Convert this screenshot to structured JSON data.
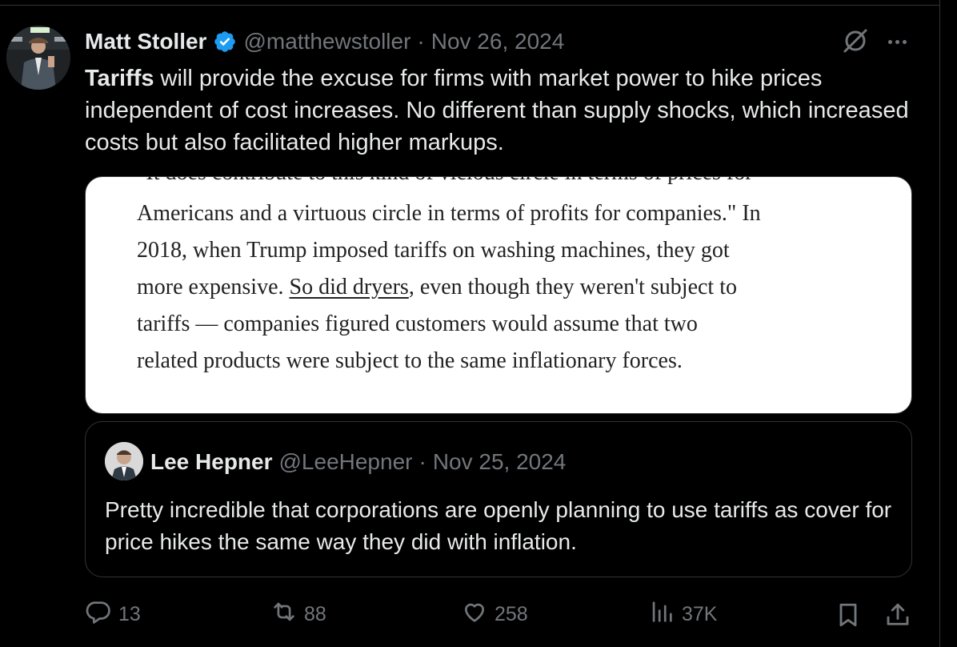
{
  "author": {
    "name": "Matt Stoller",
    "handle": "@matthewstoller",
    "separator": "·",
    "date": "Nov 26, 2024"
  },
  "tweet": {
    "bold_word": "Tariffs",
    "text_rest": " will provide the excuse for firms with market power to hike prices independent of cost increases. No different than supply shocks, which increased costs but also facilitated higher markups."
  },
  "media": {
    "cut_line": "\"It does contribute to this kind of vicious circle in terms of prices for",
    "line1": "Americans and a virtuous circle in terms of profits for companies.\" In",
    "line2": "2018, when Trump imposed tariffs on washing machines, they got",
    "line3_before": "more expensive. ",
    "line3_link": "So did dryers",
    "line3_after": ", even though they weren't subject to",
    "line4": "tariffs — companies figured customers would assume that two",
    "line5": "related products were subject to the same inflationary forces."
  },
  "quote": {
    "name": "Lee Hepner",
    "handle": "@LeeHepner",
    "separator": "·",
    "date": "Nov 25, 2024",
    "text": "Pretty incredible that corporations are openly planning to use tariffs as cover for price hikes the same way they did with inflation."
  },
  "actions": {
    "replies": "13",
    "reposts": "88",
    "likes": "258",
    "views": "37K"
  },
  "icons": {
    "verified": "verified-badge-icon",
    "grok": "grok-icon",
    "more": "more-icon",
    "reply": "reply-icon",
    "repost": "repost-icon",
    "like": "heart-icon",
    "views": "views-chart-icon",
    "bookmark": "bookmark-icon",
    "share": "share-icon"
  },
  "colors": {
    "background": "#000000",
    "text": "#e7e9ea",
    "muted": "#71767b",
    "verified_blue": "#1d9bf0",
    "border": "#2f3336"
  }
}
